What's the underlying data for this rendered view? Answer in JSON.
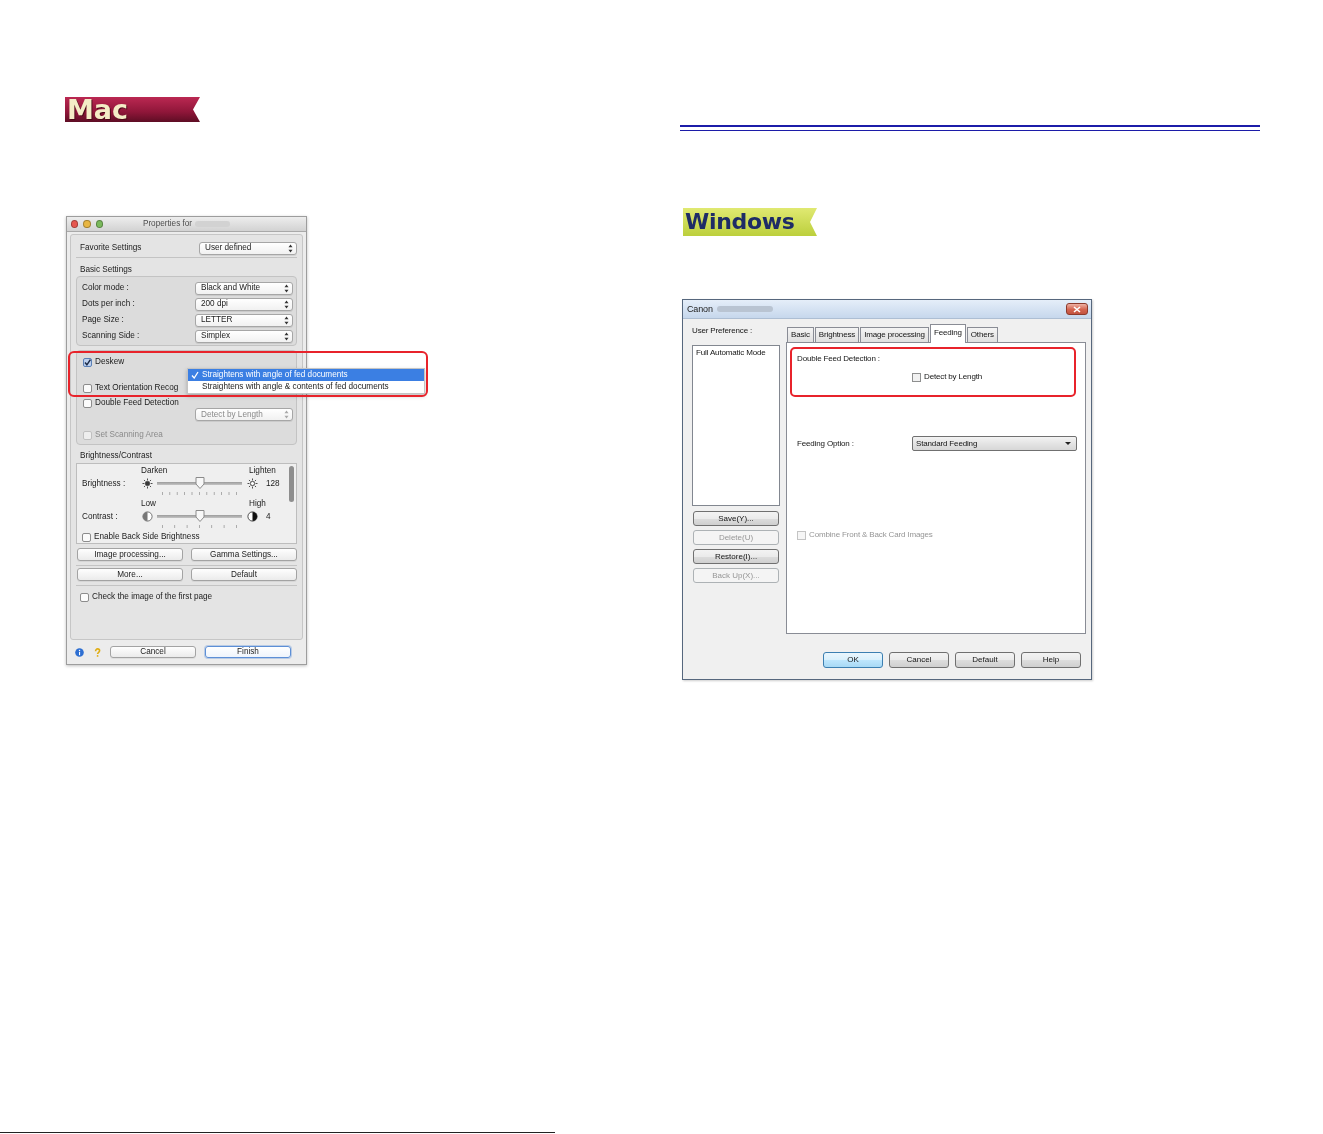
{
  "mac": {
    "badge": "Mac",
    "dialog": {
      "title": "Properties for",
      "favorite": {
        "label": "Favorite Settings",
        "value": "User defined"
      },
      "basic_heading": "Basic Settings",
      "basic_rows": [
        {
          "label": "Color mode :",
          "value": "Black and White"
        },
        {
          "label": "Dots per inch :",
          "value": "200 dpi"
        },
        {
          "label": "Page Size :",
          "value": "LETTER"
        },
        {
          "label": "Scanning Side :",
          "value": "Simplex"
        }
      ],
      "options": [
        {
          "kind": "checkbox",
          "label": "Deskew",
          "checked": true,
          "disabled": false
        },
        {
          "kind": "checkbox",
          "label": "Text Orientation Recog",
          "checked": false,
          "disabled": false
        },
        {
          "kind": "checkbox",
          "label": "Double Feed Detection",
          "checked": false,
          "disabled": false
        },
        {
          "kind": "select",
          "value": "Detect by Length",
          "disabled": true
        },
        {
          "kind": "checkbox",
          "label": "Set Scanning Area",
          "checked": false,
          "disabled": true
        }
      ],
      "deskew_menu": [
        {
          "label": "Straightens with angle of fed documents",
          "selected": true
        },
        {
          "label": "Straightens with angle & contents of fed documents",
          "selected": false
        }
      ],
      "brightness_heading": "Brightness/Contrast",
      "sliders": [
        {
          "kind": "brightness",
          "low": "Darken",
          "high": "Lighten",
          "label": "Brightness :",
          "level": 0.5,
          "reading": "128"
        },
        {
          "kind": "contrast",
          "low": "Low",
          "high": "High",
          "label": "Contrast :",
          "level": 0.5,
          "reading": "4"
        }
      ],
      "back_side": {
        "label": "Enable Back Side Brightness",
        "checked": false
      },
      "buttons": [
        "Image processing...",
        "Gamma Settings...",
        "More...",
        "Default"
      ],
      "first_page": {
        "label": "Check the image of the first page",
        "checked": false
      },
      "footer_buttons": [
        {
          "label": "Cancel",
          "default": false
        },
        {
          "label": "Finish",
          "default": true
        }
      ]
    }
  },
  "windows": {
    "badge": "Windows",
    "dialog": {
      "title": "Canon",
      "preference_label": "User Preference :",
      "preferences": [
        {
          "label": "Full Automatic Mode",
          "selected": false
        }
      ],
      "preference_buttons": [
        {
          "label": "Save(Y)...",
          "disabled": false
        },
        {
          "label": "Delete(U)",
          "disabled": true
        },
        {
          "label": "Restore(I)...",
          "disabled": false
        },
        {
          "label": "Back Up(X)...",
          "disabled": true
        }
      ],
      "tabs": [
        {
          "label": "Basic",
          "selected": false
        },
        {
          "label": "Brightness",
          "selected": false
        },
        {
          "label": "Image processing",
          "selected": false
        },
        {
          "label": "Feeding",
          "selected": true
        },
        {
          "label": "Others",
          "selected": false
        }
      ],
      "double_feed": {
        "heading": "Double Feed Detection :",
        "label": "Detect by Length",
        "checked": false
      },
      "feeding_option": {
        "label": "Feeding Option :",
        "value": "Standard Feeding"
      },
      "combine": {
        "label": "Combine Front & Back Card Images",
        "checked": false,
        "disabled": true
      },
      "footer_buttons": [
        {
          "label": "OK",
          "default": true
        },
        {
          "label": "Cancel",
          "default": false
        },
        {
          "label": "Default",
          "default": false
        },
        {
          "label": "Help",
          "default": false
        }
      ]
    }
  }
}
